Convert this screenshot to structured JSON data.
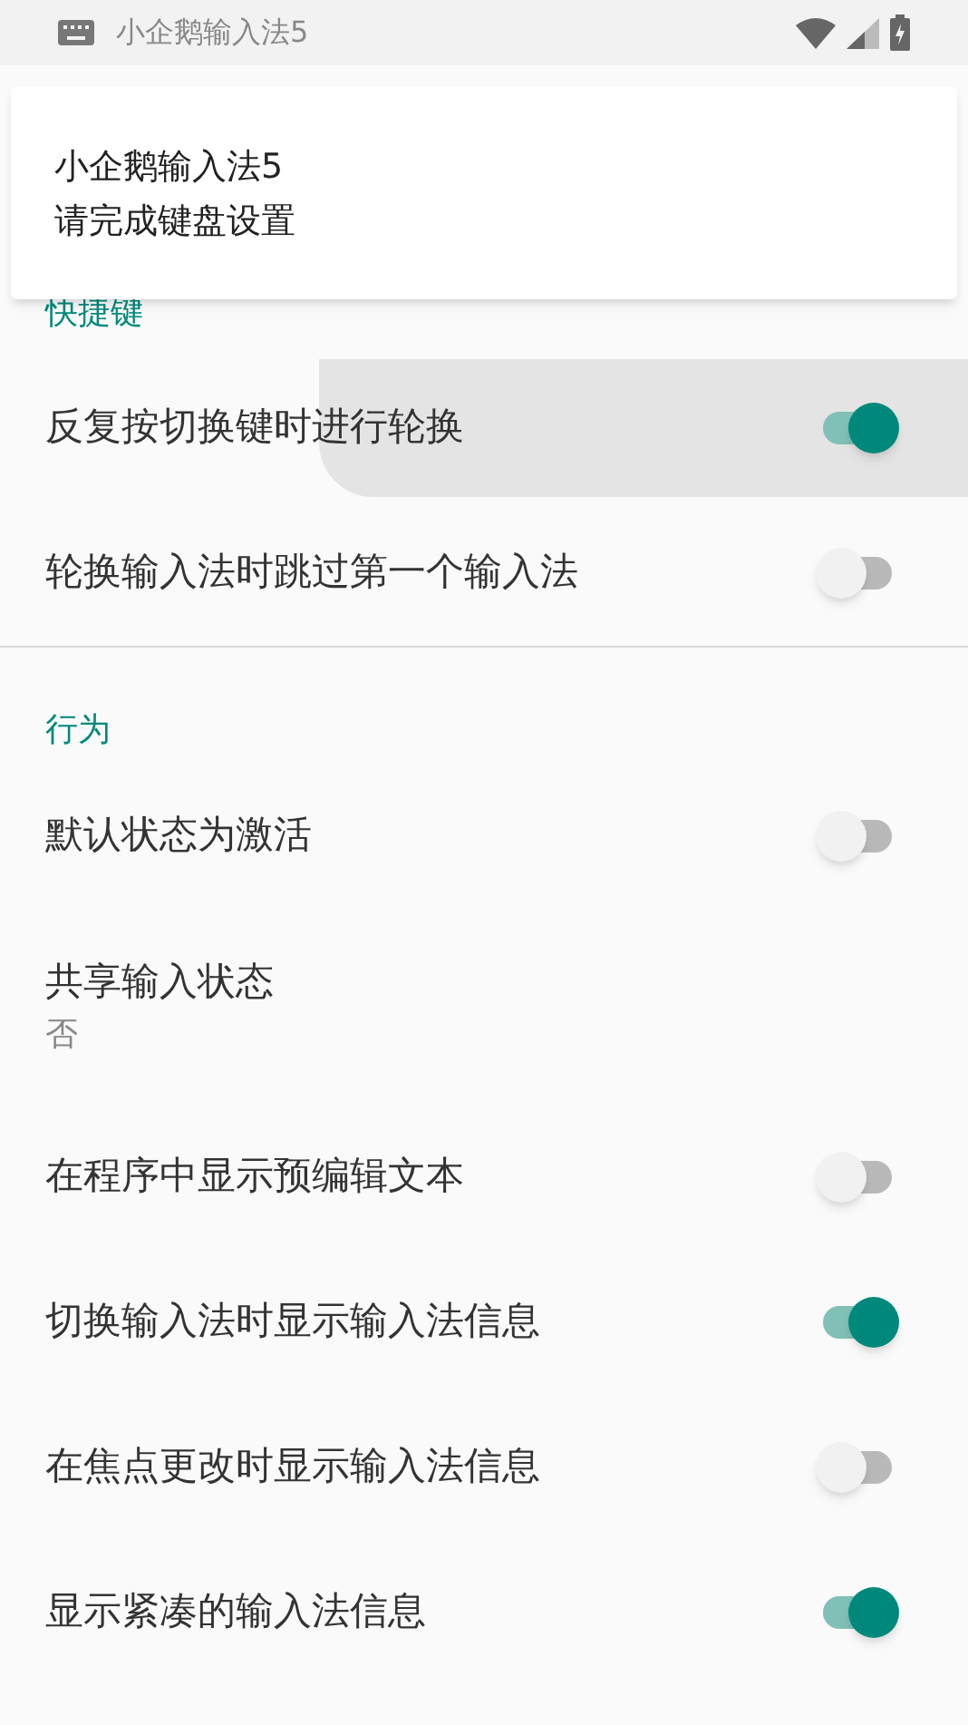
{
  "status_bar": {
    "app_name": "小企鹅输入法5"
  },
  "toast": {
    "lines": [
      "小企鹅输入法5",
      "请完成键盘设置"
    ]
  },
  "sections": [
    {
      "title": "快捷键",
      "items": [
        {
          "kind": "switch",
          "label": "反复按切换键时进行轮换",
          "on": true,
          "pressed": true
        },
        {
          "kind": "switch",
          "label": "轮换输入法时跳过第一个输入法",
          "on": false,
          "pressed": false
        }
      ]
    },
    {
      "title": "行为",
      "items": [
        {
          "kind": "switch",
          "label": "默认状态为激活",
          "on": false,
          "pressed": false
        },
        {
          "kind": "value",
          "label": "共享输入状态",
          "value": "否",
          "pressed": false
        },
        {
          "kind": "switch",
          "label": "在程序中显示预编辑文本",
          "on": false,
          "pressed": false
        },
        {
          "kind": "switch",
          "label": "切换输入法时显示输入法信息",
          "on": true,
          "pressed": false
        },
        {
          "kind": "switch",
          "label": "在焦点更改时显示输入法信息",
          "on": false,
          "pressed": false
        },
        {
          "kind": "switch",
          "label": "显示紧凑的输入法信息",
          "on": true,
          "pressed": false
        }
      ]
    }
  ]
}
